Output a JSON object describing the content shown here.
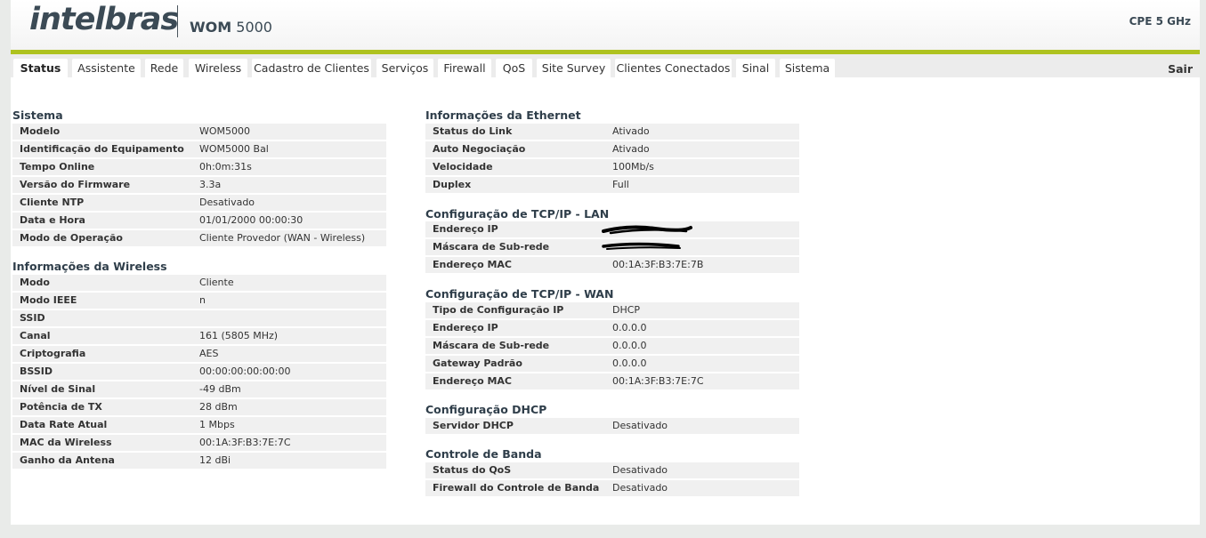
{
  "header": {
    "logo": "intelbras",
    "product_bold": "WOM",
    "product_rest": " 5000",
    "cpe": "CPE 5 GHz"
  },
  "tabs": [
    "Status",
    "Assistente",
    "Rede",
    "Wireless",
    "Cadastro de Clientes",
    "Serviços",
    "Firewall",
    "QoS",
    "Site Survey",
    "Clientes Conectados",
    "Sinal",
    "Sistema"
  ],
  "logout": "Sair",
  "sistema": {
    "title": "Sistema",
    "rows": [
      {
        "k": "Modelo",
        "v": "WOM5000"
      },
      {
        "k": "Identificação do Equipamento",
        "v": "WOM5000 Bal"
      },
      {
        "k": "Tempo Online",
        "v": "0h:0m:31s"
      },
      {
        "k": "Versão do Firmware",
        "v": "3.3a"
      },
      {
        "k": "Cliente NTP",
        "v": "Desativado"
      },
      {
        "k": "Data e Hora",
        "v": "01/01/2000 00:00:30"
      },
      {
        "k": "Modo de Operação",
        "v": "Cliente Provedor (WAN - Wireless)"
      }
    ]
  },
  "wireless": {
    "title": "Informações da Wireless",
    "rows": [
      {
        "k": "Modo",
        "v": "Cliente"
      },
      {
        "k": "Modo IEEE",
        "v": "n"
      },
      {
        "k": "SSID",
        "v": ""
      },
      {
        "k": "Canal",
        "v": "161 (5805 MHz)"
      },
      {
        "k": "Criptografia",
        "v": "AES"
      },
      {
        "k": "BSSID",
        "v": "00:00:00:00:00:00"
      },
      {
        "k": "Nível de Sinal",
        "v": "-49 dBm"
      },
      {
        "k": "Potência de TX",
        "v": "28 dBm"
      },
      {
        "k": "Data Rate Atual",
        "v": "1 Mbps"
      },
      {
        "k": "MAC da Wireless",
        "v": "00:1A:3F:B3:7E:7C"
      },
      {
        "k": "Ganho da Antena",
        "v": "12 dBi"
      }
    ]
  },
  "ethernet": {
    "title": "Informações da Ethernet",
    "rows": [
      {
        "k": "Status do Link",
        "v": "Ativado"
      },
      {
        "k": "Auto Negociação",
        "v": "Ativado"
      },
      {
        "k": "Velocidade",
        "v": "100Mb/s"
      },
      {
        "k": "Duplex",
        "v": "Full"
      }
    ]
  },
  "lan": {
    "title": "Configuração de TCP/IP - LAN",
    "rows": [
      {
        "k": "Endereço IP",
        "v": ""
      },
      {
        "k": "Máscara de Sub-rede",
        "v": ""
      },
      {
        "k": "Endereço MAC",
        "v": "00:1A:3F:B3:7E:7B"
      }
    ]
  },
  "wan": {
    "title": "Configuração de TCP/IP - WAN",
    "rows": [
      {
        "k": "Tipo de Configuração IP",
        "v": "DHCP"
      },
      {
        "k": "Endereço IP",
        "v": "0.0.0.0"
      },
      {
        "k": "Máscara de Sub-rede",
        "v": "0.0.0.0"
      },
      {
        "k": "Gateway Padrão",
        "v": "0.0.0.0"
      },
      {
        "k": "Endereço MAC",
        "v": "00:1A:3F:B3:7E:7C"
      }
    ]
  },
  "dhcp": {
    "title": "Configuração DHCP",
    "rows": [
      {
        "k": "Servidor DHCP",
        "v": "Desativado"
      }
    ]
  },
  "banda": {
    "title": "Controle de Banda",
    "rows": [
      {
        "k": "Status do QoS",
        "v": "Desativado"
      },
      {
        "k": "Firewall do Controle de Banda",
        "v": "Desativado"
      }
    ]
  },
  "colors": {
    "accent": "#aec21f",
    "text": "#3b4a55"
  }
}
